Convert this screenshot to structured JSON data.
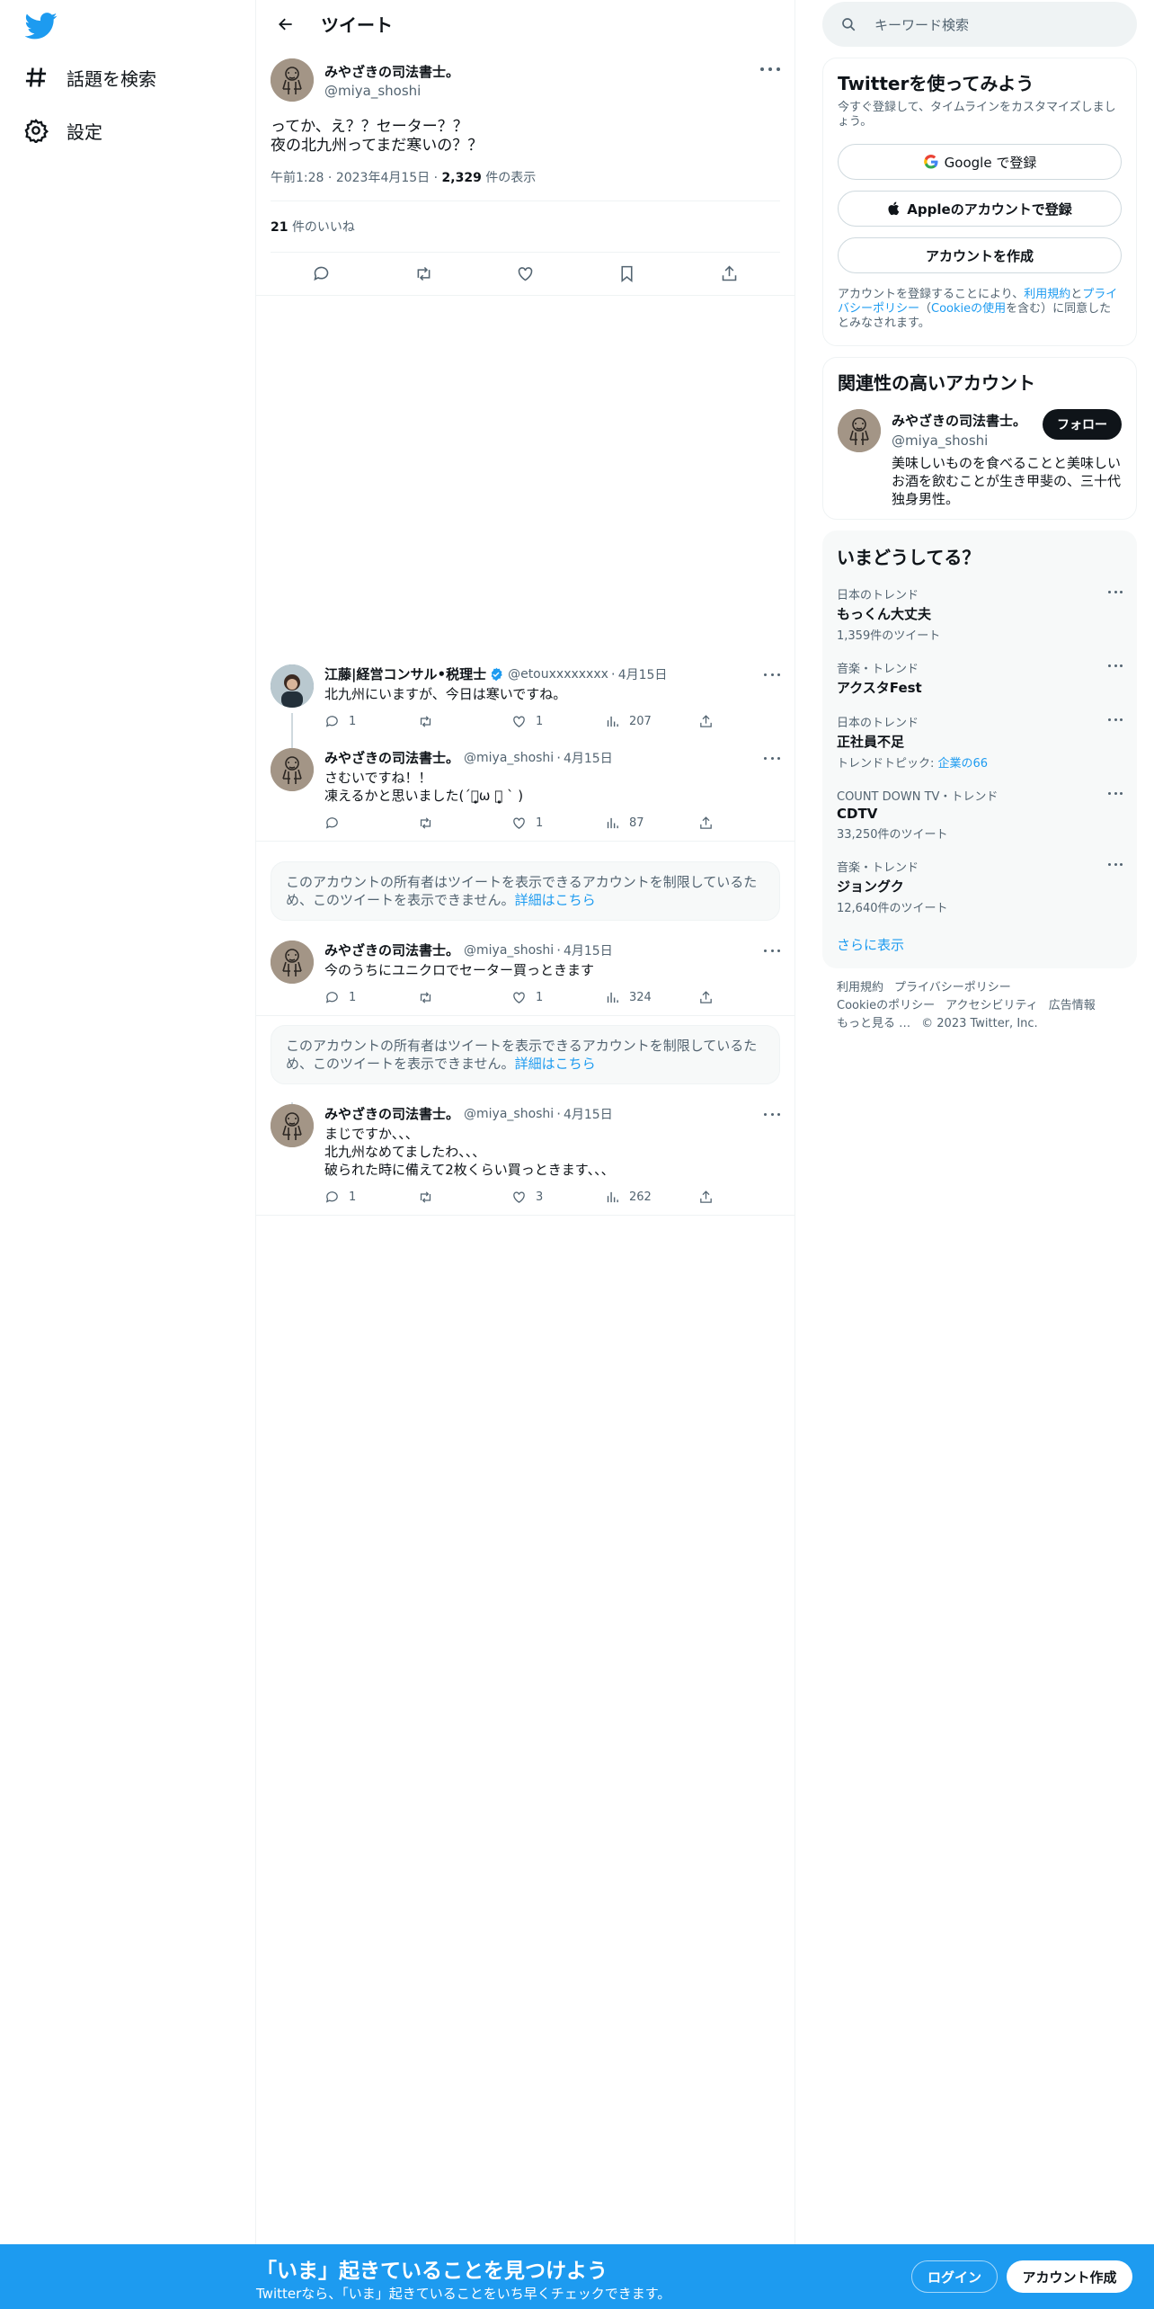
{
  "nav": {
    "explore_label": "話題を検索",
    "settings_label": "設定"
  },
  "header": {
    "title": "ツイート"
  },
  "main_tweet": {
    "name": "みやざきの司法書士。",
    "handle": "@miya_shoshi",
    "text": "ってか、え？？セーター？？\n夜の北九州ってまだ寒いの？？",
    "time": "午前1:28",
    "date": "2023年4月15日",
    "views": "2,329",
    "views_suffix": "件の表示",
    "likes": "21",
    "likes_suffix": "件のいいね"
  },
  "replies": [
    {
      "name": "江藤|経営コンサル•税理士",
      "handle": "@etouxxxxxxxx",
      "date": "4月15日",
      "text": "北九州にいますが、今日は寒いですね。",
      "replies": "1",
      "retweets": "",
      "likes": "1",
      "views": "207"
    },
    {
      "name": "みやざきの司法書士。",
      "handle": "@miya_shoshi",
      "date": "4月15日",
      "text": "さむいですね！！\n凍えるかと思いました(´ﾟ̥̥̥̥̥̥̥̥ω ﾟ̥̥̥̥̥̥̥̥̥ ` )",
      "replies": "",
      "retweets": "",
      "likes": "1",
      "views": "87"
    },
    {
      "name": "みやざきの司法書士。",
      "handle": "@miya_shoshi",
      "date": "4月15日",
      "text": "今のうちにユニクロでセーター買っときます",
      "replies": "1",
      "retweets": "",
      "likes": "1",
      "views": "324"
    },
    {
      "name": "みやざきの司法書士。",
      "handle": "@miya_shoshi",
      "date": "4月15日",
      "text": "まじですか、、、\n北九州なめてましたわ、、、\n破られた時に備えて2枚くらい買っときます、、、",
      "replies": "1",
      "retweets": "",
      "likes": "3",
      "views": "262"
    }
  ],
  "restricted": {
    "text": "このアカウントの所有者はツイートを表示できるアカウントを制限しているため、このツイートを表示できません。",
    "link": "詳細はこちら"
  },
  "search": {
    "placeholder": "キーワード検索"
  },
  "signup_card": {
    "title": "Twitterを使ってみよう",
    "subtitle": "今すぐ登録して、タイムラインをカスタマイズしましょう。",
    "google": "Google で登録",
    "apple": "Appleのアカウントで登録",
    "create": "アカウントを作成",
    "legal_1": "アカウントを登録することにより、",
    "legal_terms": "利用規約",
    "legal_and": "と",
    "legal_privacy": "プライバシーポリシー",
    "legal_paren_open": "（",
    "legal_cookie": "Cookieの使用",
    "legal_rest": "を含む）に同意したとみなされます。"
  },
  "related": {
    "title": "関連性の高いアカウント",
    "name": "みやざきの司法書士。",
    "handle": "@miya_shoshi",
    "bio": "美味しいものを食べることと美味しいお酒を飲むことが生き甲斐の、三十代独身男性。",
    "follow": "フォロー"
  },
  "trends": {
    "title": "いまどうしてる？",
    "items": [
      {
        "category": "日本のトレンド",
        "name": "もっくん大丈夫",
        "count": "1,359件のツイート"
      },
      {
        "category": "音楽・トレンド",
        "name": "アクスタFest",
        "count": ""
      },
      {
        "category": "日本のトレンド",
        "name": "正社員不足",
        "count_prefix": "トレンドトピック: ",
        "count_link": "企業の66"
      },
      {
        "category": "COUNT DOWN TV・トレンド",
        "name": "CDTV",
        "count": "33,250件のツイート"
      },
      {
        "category": "音楽・トレンド",
        "name": "ジョングク",
        "count": "12,640件のツイート"
      }
    ],
    "show_more": "さらに表示"
  },
  "footer": {
    "links": [
      "利用規約",
      "プライバシーポリシー",
      "Cookieのポリシー",
      "アクセシビリティ",
      "広告情報",
      "もっと見る …",
      "© 2023 Twitter, Inc."
    ]
  },
  "banner": {
    "title": "「いま」起きていることを見つけよう",
    "subtitle": "Twitterなら、「いま」起きていることをいち早くチェックできます。",
    "login": "ログイン",
    "signup": "アカウント作成"
  },
  "colors": {
    "accent": "#1d9bf0",
    "text": "#0f1419",
    "muted": "#536471"
  }
}
